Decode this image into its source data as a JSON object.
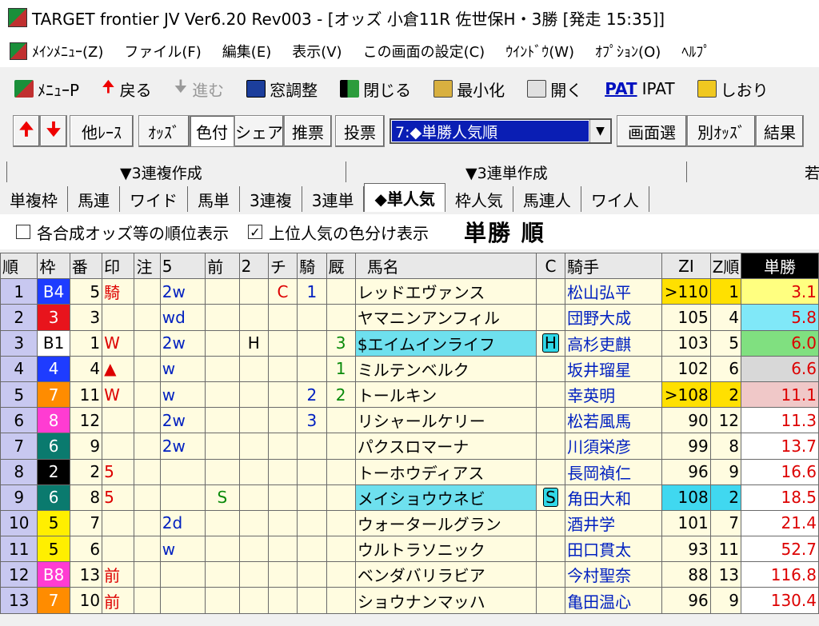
{
  "title": "TARGET frontier JV  Ver6.20  Rev003 - [オッズ 小倉11R 佐世保H・3勝 [発走 15:35]]",
  "menu": [
    "ﾒｲﾝﾒﾆｭｰ(Z)",
    "ファイル(F)",
    "編集(E)",
    "表示(V)",
    "この画面の設定(C)",
    "ｳｲﾝﾄﾞｳ(W)",
    "ｵﾌﾟｼｮﾝ(O)",
    "ﾍﾙﾌﾟ"
  ],
  "toolbar1": {
    "menu_p": "ﾒﾆｭｰP",
    "back": "戻る",
    "forward": "進む",
    "window_adjust": "窓調整",
    "close": "閉じる",
    "minimize": "最小化",
    "open": "開く",
    "ipat_icon": "PAT",
    "ipat": "IPAT",
    "bookmark": "しおり"
  },
  "toolbar2": {
    "other_race": "他ﾚｰｽ",
    "odds": "ｵｯｽﾞ",
    "color": "色付",
    "share": "シェア",
    "recommend": "推票",
    "vote": "投票",
    "combo_value": "7:◆単勝人気順",
    "screen_select": "画面選",
    "other_odds": "別ｵｯｽﾞ",
    "result": "結果"
  },
  "tabs_top": {
    "trio": "▼3連複作成",
    "trifecta": "▼3連単作成",
    "right": "若"
  },
  "tabs": [
    "単複枠",
    "馬連",
    "ワイド",
    "馬単",
    "3連複",
    "3連単",
    "◆単人気",
    "枠人気",
    "馬連人",
    "ワイ人"
  ],
  "options": {
    "opt1": "各合成オッズ等の順位表示",
    "opt2": "上位人気の色分け表示",
    "checked2": "✓",
    "heading": "単勝 順"
  },
  "columns": [
    "順",
    "枠",
    "番",
    "印",
    "注",
    "5",
    "前",
    "2",
    "チ",
    "騎",
    "厩",
    "馬名",
    "C",
    "騎手",
    "ZI",
    "Z順",
    "単勝"
  ],
  "rows": [
    {
      "rank": "1",
      "waku": "B4",
      "ban": "5",
      "shirushi": "騎",
      "chu": "",
      "go": "2w",
      "mae": "",
      "ni": "",
      "chi": "C",
      "ki": "1",
      "kyu": "",
      "name": "レッドエヴァンス",
      "c": "",
      "jockey": "松山弘平",
      "zi": ">110",
      "zjun": "1",
      "odds": "3.1"
    },
    {
      "rank": "2",
      "waku": "3",
      "ban": "3",
      "shirushi": "",
      "chu": "",
      "go": "wd",
      "mae": "",
      "ni": "",
      "chi": "",
      "ki": "",
      "kyu": "",
      "name": "ヤマニンアンフィル",
      "c": "",
      "jockey": "団野大成",
      "zi": "105",
      "zjun": "4",
      "odds": "5.8"
    },
    {
      "rank": "3",
      "waku": "B1",
      "ban": "1",
      "shirushi": "W",
      "chu": "",
      "go": "2w",
      "mae": "",
      "ni": "H",
      "chi": "",
      "ki": "",
      "kyu": "3",
      "name": "$エイムインライフ",
      "c": "H",
      "jockey": "高杉吏麒",
      "zi": "103",
      "zjun": "5",
      "odds": "6.0"
    },
    {
      "rank": "4",
      "waku": "4",
      "ban": "4",
      "shirushi": "▲",
      "chu": "",
      "go": "w",
      "mae": "",
      "ni": "",
      "chi": "",
      "ki": "",
      "kyu": "1",
      "name": "ミルテンベルク",
      "c": "",
      "jockey": "坂井瑠星",
      "zi": "102",
      "zjun": "6",
      "odds": "6.6"
    },
    {
      "rank": "5",
      "waku": "7",
      "ban": "11",
      "shirushi": "W",
      "chu": "",
      "go": "w",
      "mae": "",
      "ni": "",
      "chi": "",
      "ki": "2",
      "kyu": "2",
      "name": "トールキン",
      "c": "",
      "jockey": "幸英明",
      "zi": ">108",
      "zjun": "2",
      "odds": "11.1"
    },
    {
      "rank": "6",
      "waku": "8",
      "ban": "12",
      "shirushi": "",
      "chu": "",
      "go": "2w",
      "mae": "",
      "ni": "",
      "chi": "",
      "ki": "3",
      "kyu": "",
      "name": "リシャールケリー",
      "c": "",
      "jockey": "松若風馬",
      "zi": "90",
      "zjun": "12",
      "odds": "11.3"
    },
    {
      "rank": "7",
      "waku": "6",
      "ban": "9",
      "shirushi": "",
      "chu": "",
      "go": "2w",
      "mae": "",
      "ni": "",
      "chi": "",
      "ki": "",
      "kyu": "",
      "name": "パクスロマーナ",
      "c": "",
      "jockey": "川須栄彦",
      "zi": "99",
      "zjun": "8",
      "odds": "13.7"
    },
    {
      "rank": "8",
      "waku": "2",
      "ban": "2",
      "shirushi": "5",
      "chu": "",
      "go": "",
      "mae": "",
      "ni": "",
      "chi": "",
      "ki": "",
      "kyu": "",
      "name": "トーホウディアス",
      "c": "",
      "jockey": "長岡禎仁",
      "zi": "96",
      "zjun": "9",
      "odds": "16.6"
    },
    {
      "rank": "9",
      "waku": "6",
      "ban": "8",
      "shirushi": "5",
      "chu": "",
      "go": "",
      "mae": "S",
      "ni": "",
      "chi": "",
      "ki": "",
      "kyu": "",
      "name": "メイショウウネビ",
      "c": "S",
      "jockey": "角田大和",
      "zi": "108",
      "zjun": "2",
      "odds": "18.5"
    },
    {
      "rank": "10",
      "waku": "5",
      "ban": "7",
      "shirushi": "",
      "chu": "",
      "go": "2d",
      "mae": "",
      "ni": "",
      "chi": "",
      "ki": "",
      "kyu": "",
      "name": "ウォータールグラン",
      "c": "",
      "jockey": "酒井学",
      "zi": "101",
      "zjun": "7",
      "odds": "21.4"
    },
    {
      "rank": "11",
      "waku": "5",
      "ban": "6",
      "shirushi": "",
      "chu": "",
      "go": "w",
      "mae": "",
      "ni": "",
      "chi": "",
      "ki": "",
      "kyu": "",
      "name": "ウルトラソニック",
      "c": "",
      "jockey": "田口貫太",
      "zi": "93",
      "zjun": "11",
      "odds": "52.7"
    },
    {
      "rank": "12",
      "waku": "B8",
      "ban": "13",
      "shirushi": "前",
      "chu": "",
      "go": "",
      "mae": "",
      "ni": "",
      "chi": "",
      "ki": "",
      "kyu": "",
      "name": "ベンダバリラビア",
      "c": "",
      "jockey": "今村聖奈",
      "zi": "88",
      "zjun": "13",
      "odds": "116.8"
    },
    {
      "rank": "13",
      "waku": "7",
      "ban": "10",
      "shirushi": "前",
      "chu": "",
      "go": "",
      "mae": "",
      "ni": "",
      "chi": "",
      "ki": "",
      "kyu": "",
      "name": "ショウナンマッハ",
      "c": "",
      "jockey": "亀田温心",
      "zi": "96",
      "zjun": "9",
      "odds": "130.4"
    }
  ],
  "colors": {
    "waku": {
      "1": "#ffffff",
      "2": "#000000",
      "3": "#e8141c",
      "4": "#1e3cff",
      "5": "#ffef00",
      "6": "#0a7a6e",
      "7": "#ff8c00",
      "8": "#ff3cd2"
    },
    "waku_text": {
      "1": "#000000",
      "2": "#ffffff",
      "3": "#ffffff",
      "4": "#ffffff",
      "5": "#000000",
      "6": "#ffffff",
      "7": "#ffffff",
      "8": "#ffffff"
    },
    "odds_bg": [
      "#ffff80",
      "#80e8f8",
      "#80e080",
      "#d8d8d8",
      "#f0c8c8"
    ],
    "zi_top": "#ffe000",
    "zi_cyan": "#40d8f0"
  }
}
